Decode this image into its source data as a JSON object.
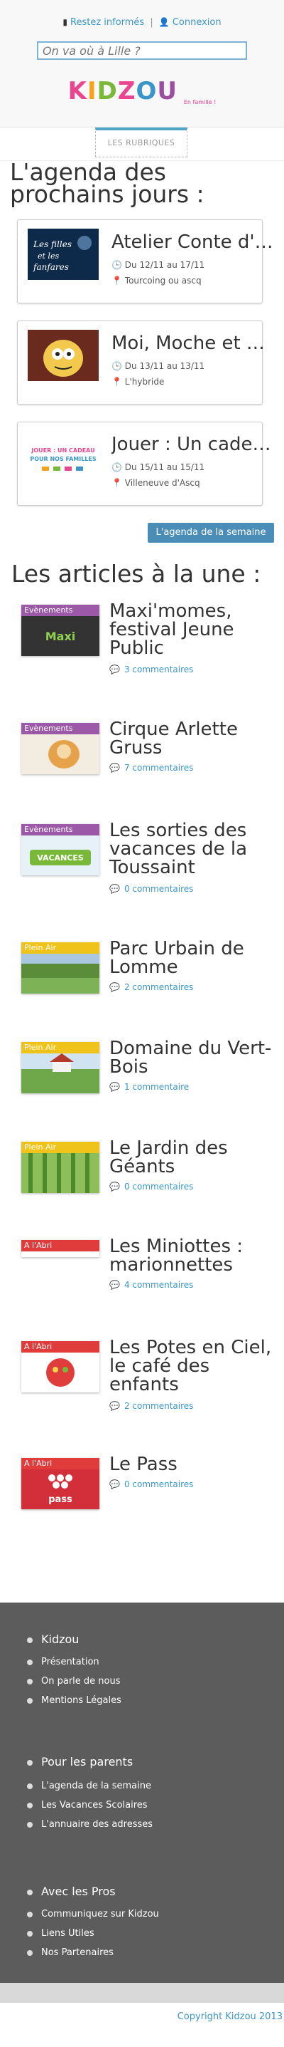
{
  "header": {
    "stay_informed": "Restez informés",
    "separator": "|",
    "login": "Connexion",
    "search_placeholder": "On va où à Lille ?",
    "logo_letters": [
      "K",
      "I",
      "D",
      "Z",
      "O",
      "U"
    ],
    "logo_colors": [
      "#e9468f",
      "#f6a21d",
      "#7ab83a",
      "#e9468f",
      "#3a96c8",
      "#9c4fa0"
    ],
    "logo_tagline": "En famille !",
    "rubriques": "LES RUBRIQUES"
  },
  "agenda": {
    "title": "L'agenda des prochains jours :",
    "events": [
      {
        "title": "Atelier Conte d'hiver",
        "date": "Du 12/11 au 17/11",
        "location": "Tourcoing ou ascq",
        "img": "les-filles-et-les-fanfares"
      },
      {
        "title": "Moi, Moche et Méchant",
        "date": "Du 13/11 au 13/11",
        "location": "L'hybride",
        "img": "minion-cartoon"
      },
      {
        "title": "Jouer : Un cadeau pour nos familles",
        "date": "Du 15/11 au 15/11",
        "location": "Villeneuve d'Ascq",
        "img": "jouer-un-cadeau"
      }
    ],
    "week_button": "L'agenda de la semaine"
  },
  "articles": {
    "title": "Les articles à la une :",
    "items": [
      {
        "category": "Evènements",
        "cat_color": "#9c59a8",
        "title": "Maxi'momes, festival Jeune Public",
        "comments": "3 commentaires"
      },
      {
        "category": "Evènements",
        "cat_color": "#9c59a8",
        "title": "Cirque Arlette Gruss",
        "comments": "7 commentaires"
      },
      {
        "category": "Evènements",
        "cat_color": "#9c59a8",
        "title": "Les sorties des vacances de la Toussaint",
        "comments": "0 commentaires"
      },
      {
        "category": "Plein Air",
        "cat_color": "#f0c31a",
        "title": "Parc Urbain de Lomme",
        "comments": "2 commentaires"
      },
      {
        "category": "Plein Air",
        "cat_color": "#f0c31a",
        "title": "Domaine du Vert-Bois",
        "comments": "1 commentaire"
      },
      {
        "category": "Plein Air",
        "cat_color": "#f0c31a",
        "title": "Le Jardin des Géants",
        "comments": "0 commentaires"
      },
      {
        "category": "A l'Abri",
        "cat_color": "#e03c3c",
        "title": "Les Miniottes : marionnettes",
        "comments": "4 commentaires"
      },
      {
        "category": "A l'Abri",
        "cat_color": "#e03c3c",
        "title": "Les Potes en Ciel, le café des enfants",
        "comments": "2 commentaires"
      },
      {
        "category": "A l'Abri",
        "cat_color": "#e03c3c",
        "title": "Le Pass",
        "comments": "0 commentaires"
      }
    ]
  },
  "footer": {
    "sections": [
      {
        "title": "Kidzou",
        "items": [
          "Présentation",
          "On parle de nous",
          "Mentions Légales"
        ]
      },
      {
        "title": "Pour les parents",
        "items": [
          "L'agenda de la semaine",
          "Les Vacances Scolaires",
          "L'annuaire des adresses"
        ]
      },
      {
        "title": "Avec les Pros",
        "items": [
          "Communiquez sur Kidzou",
          "Liens Utiles",
          "Nos Partenaires"
        ]
      }
    ],
    "copyright": "Copyright Kidzou 2013"
  }
}
